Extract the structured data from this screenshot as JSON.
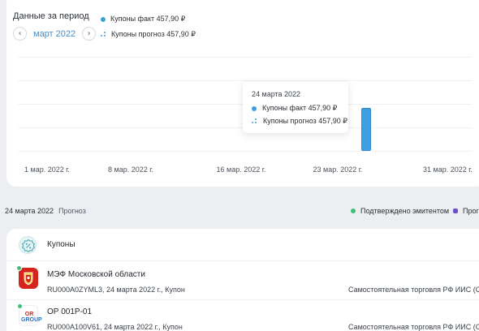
{
  "header": {
    "period_title": "Данные за период",
    "month": "март 2022",
    "prev_icon": "chevron-left-icon",
    "next_icon": "chevron-right-icon"
  },
  "legend": {
    "fact_label": "Купоны факт 457,90 ₽",
    "forecast_label": "Купоны прогноз 457,90 ₽"
  },
  "chart_data": {
    "type": "bar",
    "x_ticks": [
      "1 мар. 2022 г.",
      "8 мар. 2022 г.",
      "16 мар. 2022 г.",
      "23 мар. 2022 г.",
      "31 мар. 2022 г."
    ],
    "x_range": [
      "2022-03-01",
      "2022-03-31"
    ],
    "series": [
      {
        "name": "Купоны факт",
        "points": [
          {
            "date": "2022-03-24",
            "value": 457.9
          }
        ]
      },
      {
        "name": "Купоны прогноз",
        "points": [
          {
            "date": "2022-03-24",
            "value": 457.9
          }
        ]
      }
    ],
    "grid": true,
    "colors": {
      "fact": "#3d9ee0",
      "forecast": "#3d9ee0"
    }
  },
  "tooltip": {
    "date": "24 марта 2022",
    "fact": "Купоны факт 457,90 ₽",
    "forecast": "Купоны прогноз 457,90 ₽"
  },
  "status": {
    "date": "24 марта 2022",
    "type": "Прогноз",
    "confirmed_label": "Подтверждено эмитентом",
    "second_label": "Прогн"
  },
  "section": {
    "title": "Купоны",
    "icon": "percent-badge-icon"
  },
  "rows": [
    {
      "title": "МЭФ Московской области",
      "subtitle": "RU000A0ZYML3, 24 марта 2022 г., Купон",
      "account": "Самостоятельная торговля РФ ИИС (Счет"
    },
    {
      "title": "ОР 001Р-01",
      "subtitle": "RU000A100V61, 24 марта 2022 г., Купон",
      "account": "Самостоятельная торговля РФ ИИС (Счет",
      "logo_text_top": "OR",
      "logo_text_bottom": "GROUP"
    }
  ]
}
